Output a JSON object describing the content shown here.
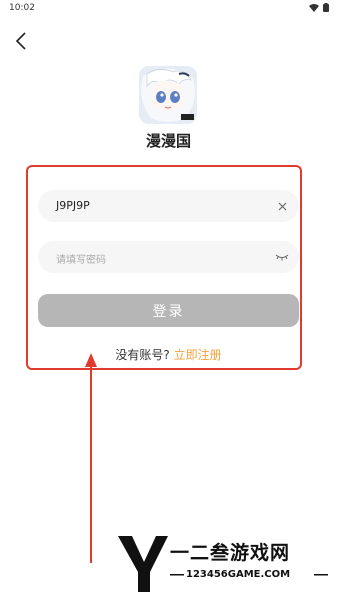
{
  "status_bar": {
    "time": "10:02"
  },
  "app": {
    "name": "漫漫国"
  },
  "form": {
    "account_value": "J9PJ9P",
    "password_placeholder": "请填写密码",
    "login_label": "登录",
    "register_prompt": "没有账号?",
    "register_link": "立即注册"
  },
  "watermark": {
    "title": "一二叁游戏网",
    "url": "123456GAME.COM"
  },
  "colors": {
    "highlight_box": "#e03b2c",
    "link": "#f2a23a",
    "login_button": "#b6b6b6",
    "input_bg": "#f6f6f6"
  },
  "icons": [
    "chevron-left-icon",
    "wifi-icon",
    "battery-icon",
    "clear-icon",
    "eye-closed-icon"
  ]
}
